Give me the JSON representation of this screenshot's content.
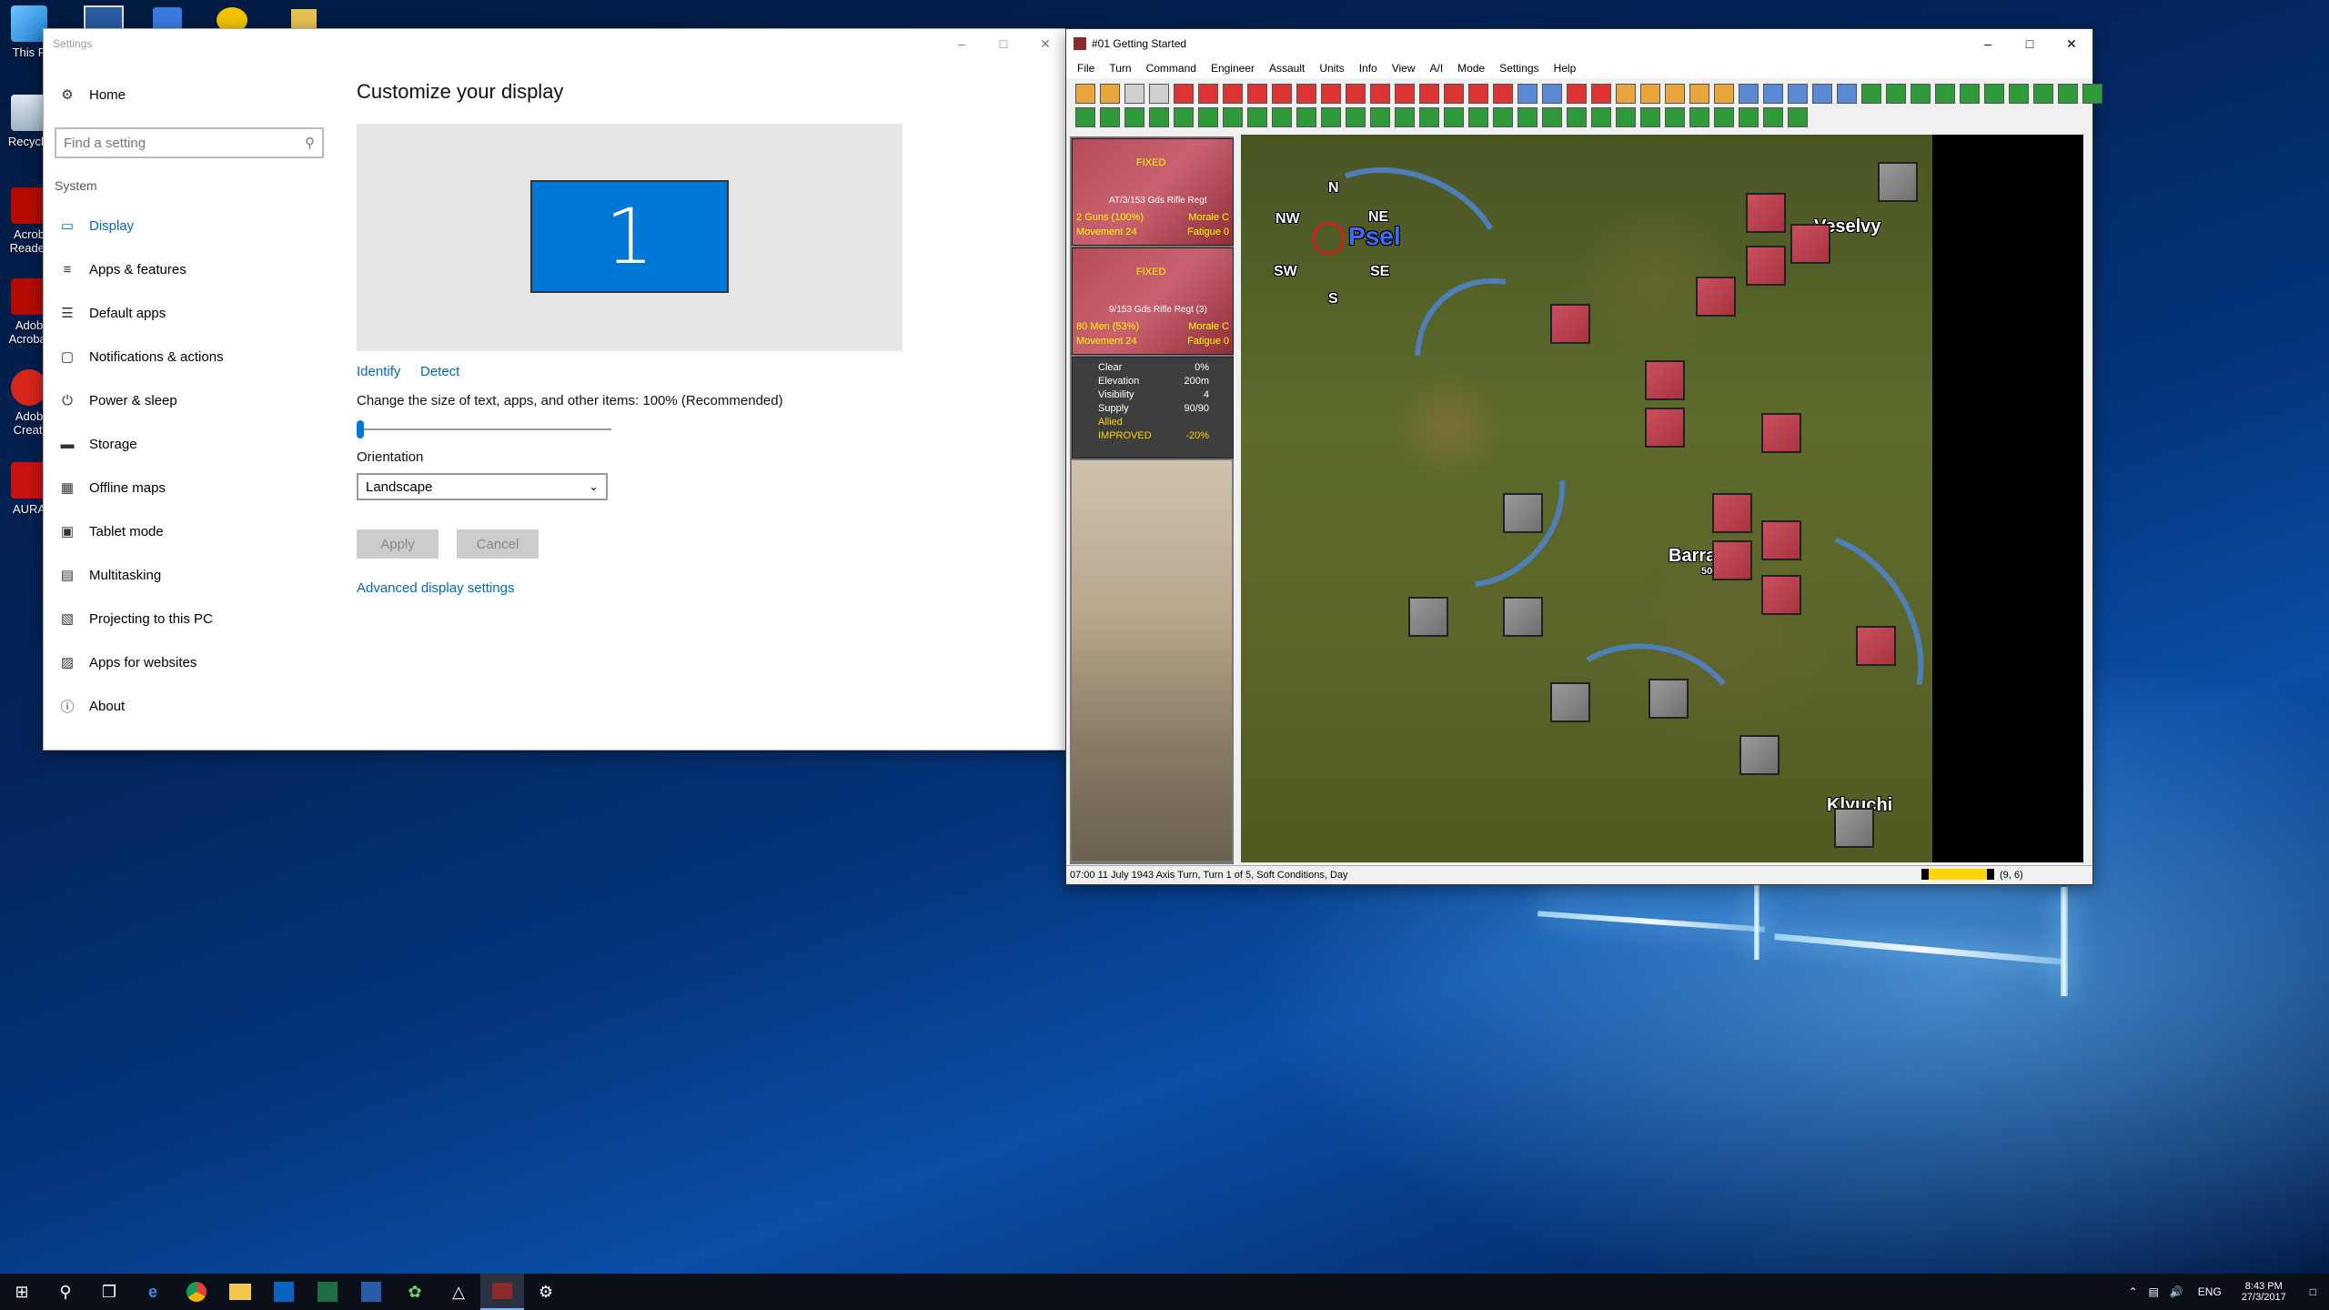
{
  "desktop": {
    "icons": [
      {
        "label": "This P"
      },
      {
        "label": "Recycle"
      },
      {
        "label": "Acrob Reader"
      },
      {
        "label": "Adob Acrobat"
      },
      {
        "label": "Adob Creati"
      },
      {
        "label": "AURA"
      }
    ]
  },
  "settings": {
    "title": "Settings",
    "home_label": "Home",
    "search_placeholder": "Find a setting",
    "section": "System",
    "nav": [
      {
        "label": "Display",
        "icon": "monitor-icon",
        "active": true
      },
      {
        "label": "Apps & features",
        "icon": "list-icon"
      },
      {
        "label": "Default apps",
        "icon": "default-apps-icon"
      },
      {
        "label": "Notifications & actions",
        "icon": "notification-icon"
      },
      {
        "label": "Power & sleep",
        "icon": "power-icon"
      },
      {
        "label": "Storage",
        "icon": "storage-icon"
      },
      {
        "label": "Offline maps",
        "icon": "map-icon"
      },
      {
        "label": "Tablet mode",
        "icon": "tablet-icon"
      },
      {
        "label": "Multitasking",
        "icon": "multitask-icon"
      },
      {
        "label": "Projecting to this PC",
        "icon": "project-icon"
      },
      {
        "label": "Apps for websites",
        "icon": "web-apps-icon"
      },
      {
        "label": "About",
        "icon": "info-icon"
      }
    ],
    "page_title": "Customize your display",
    "monitor_number": "1",
    "identify": "Identify",
    "detect": "Detect",
    "scale_label": "Change the size of text, apps, and other items: 100% (Recommended)",
    "scale_value": 0,
    "orientation_label": "Orientation",
    "orientation_value": "Landscape",
    "apply": "Apply",
    "cancel": "Cancel",
    "advanced": "Advanced display settings"
  },
  "game": {
    "title": "#01 Getting Started",
    "menu": [
      "File",
      "Turn",
      "Command",
      "Engineer",
      "Assault",
      "Units",
      "Info",
      "View",
      "A/I",
      "Mode",
      "Settings",
      "Help"
    ],
    "unit1": {
      "status": "FIXED",
      "name": "AT/3/153 Gds Rifle Regt",
      "strength": "2 Guns (100%)",
      "morale": "Morale C",
      "movement": "Movement 24",
      "fatigue": "Fatigue 0"
    },
    "unit2": {
      "status": "FIXED",
      "name": "9/153 Gds Rifle Regt (3)",
      "strength": "80 Men (53%)",
      "morale": "Morale C",
      "movement": "Movement 24",
      "fatigue": "Fatigue 0"
    },
    "terrain": [
      {
        "k": "Clear",
        "v": "0%"
      },
      {
        "k": "Elevation",
        "v": "200m"
      },
      {
        "k": "Visibility",
        "v": "4"
      },
      {
        "k": "Supply",
        "v": "90/90"
      },
      {
        "k": "Allied",
        "v": ""
      },
      {
        "k": "IMPROVED",
        "v": "-20%"
      }
    ],
    "compass": {
      "n": "N",
      "ne": "NE",
      "se": "SE",
      "s": "S",
      "sw": "SW",
      "nw": "NW"
    },
    "map_labels": {
      "psel": "Psel",
      "veselvy": "Veselvy",
      "barracks": "Barracks",
      "klyuchi": "Klyuchi",
      "barracks_value": "50"
    },
    "status": "07:00 11 July 1943 Axis Turn, Turn 1 of 5, Soft Conditions, Day",
    "coords": "(9, 6)"
  },
  "taskbar": {
    "lang": "ENG",
    "time": "8:43 PM",
    "date": "27/3/2017"
  },
  "colors": {
    "accent": "#0078d7",
    "soviet": "#c9505e",
    "german": "#8a8a8a"
  }
}
